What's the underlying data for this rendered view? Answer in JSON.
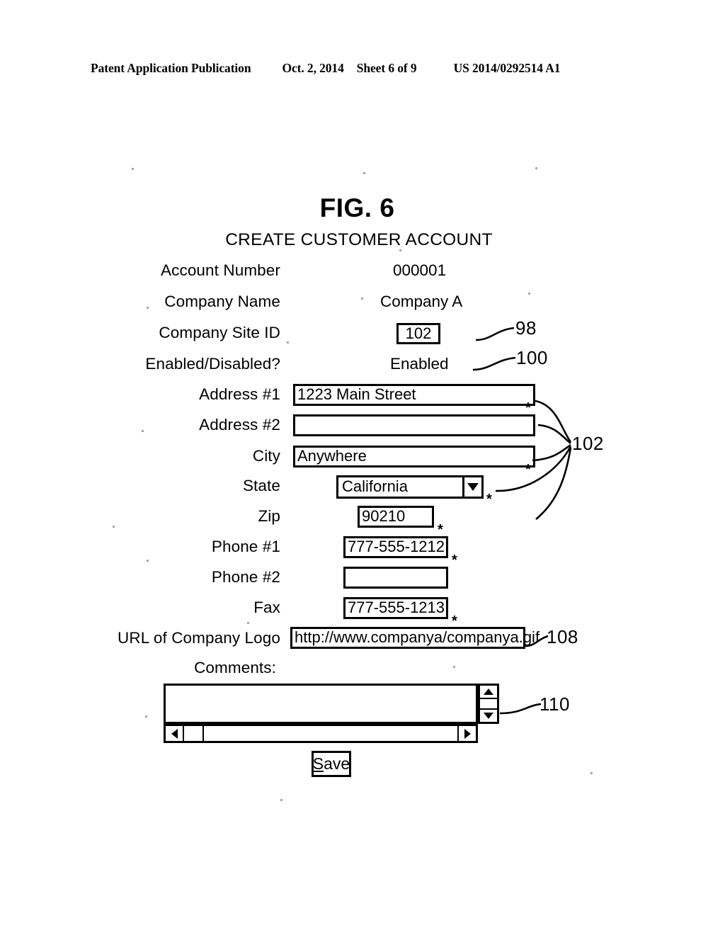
{
  "header": {
    "publication": "Patent Application Publication",
    "date": "Oct. 2, 2014",
    "sheet": "Sheet 6 of 9",
    "patent_number": "US 2014/0292514 A1"
  },
  "figure": {
    "label": "FIG. 6",
    "title": "CREATE CUSTOMER ACCOUNT"
  },
  "form": {
    "fields": [
      {
        "label": "Account Number",
        "value": "000001",
        "type": "static"
      },
      {
        "label": "Company Name",
        "value": "Company A",
        "type": "static"
      },
      {
        "label": "Company Site ID",
        "value": "102",
        "type": "textbox-small"
      },
      {
        "label": "Enabled/Disabled?",
        "value": "Enabled",
        "type": "static"
      },
      {
        "label": "Address #1",
        "value": "1223 Main Street",
        "type": "textbox",
        "required": true
      },
      {
        "label": "Address #2",
        "value": "",
        "type": "textbox",
        "required": false
      },
      {
        "label": "City",
        "value": "Anywhere",
        "type": "textbox",
        "required": true
      },
      {
        "label": "State",
        "value": "California",
        "type": "dropdown",
        "required": true
      },
      {
        "label": "Zip",
        "value": "90210",
        "type": "textbox",
        "required": true
      },
      {
        "label": "Phone #1",
        "value": "777-555-1212",
        "type": "textbox",
        "required": true
      },
      {
        "label": "Phone #2",
        "value": "",
        "type": "textbox",
        "required": false
      },
      {
        "label": "Fax",
        "value": "777-555-1213",
        "type": "textbox",
        "required": true
      },
      {
        "label": "URL of Company Logo",
        "value": "http://www.companya/companya.gif",
        "type": "textbox",
        "required": false
      }
    ],
    "comments_label": "Comments:",
    "comments_value": "",
    "save_label": "Save",
    "save_accelerator": "S",
    "save_rest": "ave",
    "required_marker": "*"
  },
  "callouts": [
    {
      "id": "98",
      "target": "Company Site ID text box"
    },
    {
      "id": "100",
      "target": "Enabled/Disabled value"
    },
    {
      "id": "102",
      "target": "Address/City/State/Zip entry fields"
    },
    {
      "id": "108",
      "target": "URL of Company Logo text box"
    },
    {
      "id": "110",
      "target": "Comments scrolling text area"
    }
  ],
  "colors": {
    "ink": "#000000",
    "paper": "#ffffff"
  }
}
